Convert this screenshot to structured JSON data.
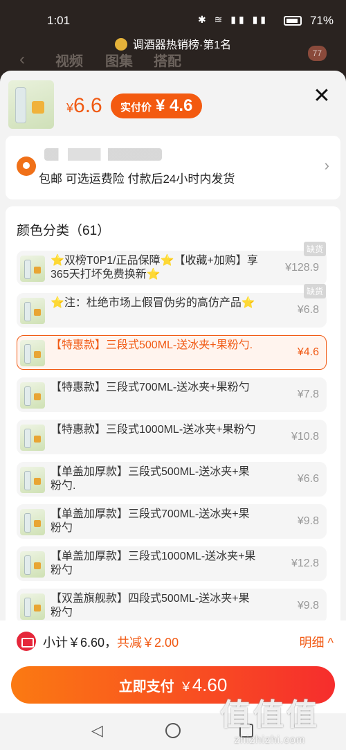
{
  "status_bar": {
    "time": "1:01",
    "icons": "✱ ≋ ▮▮ ▮▮",
    "battery": "71%"
  },
  "banner": {
    "rank": "调酒器热销榜·第1名"
  },
  "background_nav": {
    "back": "‹",
    "tabs": [
      "视频",
      "图集",
      "搭配"
    ],
    "cart_count": "77"
  },
  "sheet": {
    "header": {
      "currency": "¥",
      "price": "6.6",
      "pay_label": "实付价",
      "pay_amount": "¥ 4.6",
      "close": "✕"
    },
    "address": {
      "shipping": "包邮  可选运费险  付款后24小时内发货",
      "chevron": "›"
    },
    "sku": {
      "title": "颜色分类（61）",
      "sold_out_label": "缺货",
      "items": [
        {
          "name": "⭐双榜T0P1/正品保障⭐【收藏+加购】享365天打坏免费换新⭐",
          "price": "¥128.9",
          "sold_out": true,
          "selected": false
        },
        {
          "name": "⭐注：杜绝市场上假冒伪劣的高仿产品⭐",
          "price": "¥6.8",
          "sold_out": true,
          "selected": false
        },
        {
          "name": "【特惠款】三段式500ML-送冰夹+果粉勺.",
          "price": "¥4.6",
          "sold_out": false,
          "selected": true
        },
        {
          "name": "【特惠款】三段式700ML-送冰夹+果粉勺",
          "price": "¥7.8",
          "sold_out": false,
          "selected": false
        },
        {
          "name": "【特惠款】三段式1000ML-送冰夹+果粉勺",
          "price": "¥10.8",
          "sold_out": false,
          "selected": false
        },
        {
          "name": "【单盖加厚款】三段式500ML-送冰夹+果粉勺.",
          "price": "¥6.6",
          "sold_out": false,
          "selected": false
        },
        {
          "name": "【单盖加厚款】三段式700ML-送冰夹+果粉勺",
          "price": "¥9.8",
          "sold_out": false,
          "selected": false
        },
        {
          "name": "【单盖加厚款】三段式1000ML-送冰夹+果粉勺",
          "price": "¥12.8",
          "sold_out": false,
          "selected": false
        },
        {
          "name": "【双盖旗舰款】四段式500ML-送冰夹+果粉勺",
          "price": "¥9.8",
          "sold_out": false,
          "selected": false
        }
      ]
    }
  },
  "footer": {
    "subtotal": "小计￥6.60，",
    "discount": "共减￥2.00",
    "detail": "明细 ^",
    "pay_label": "立即支付",
    "pay_currency": "￥",
    "pay_amount": "4.60"
  },
  "nav_bar": {
    "back": "◁"
  },
  "watermark": {
    "logo": "值值值",
    "site": "zhizhizhi.com"
  }
}
